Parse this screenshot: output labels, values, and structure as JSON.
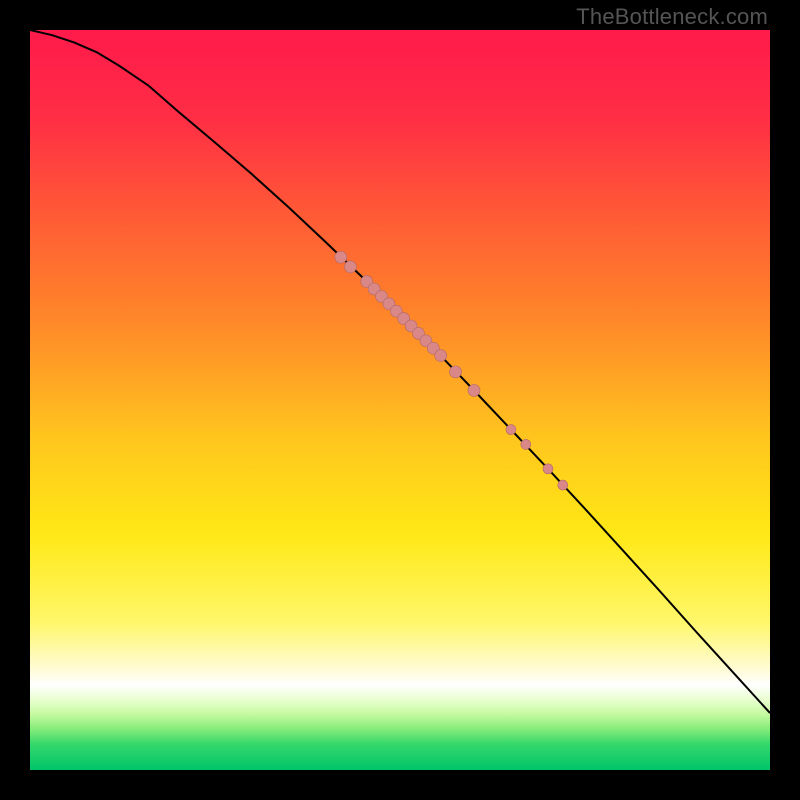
{
  "watermark": "TheBottleneck.com",
  "chart_data": {
    "type": "line",
    "title": "",
    "xlabel": "",
    "ylabel": "",
    "xlim": [
      0,
      100
    ],
    "ylim": [
      0,
      100
    ],
    "background_gradient_stops": [
      {
        "offset": 0.0,
        "color": "#ff1a4b"
      },
      {
        "offset": 0.12,
        "color": "#ff2e45"
      },
      {
        "offset": 0.25,
        "color": "#ff5a36"
      },
      {
        "offset": 0.4,
        "color": "#ff8a28"
      },
      {
        "offset": 0.55,
        "color": "#ffc51e"
      },
      {
        "offset": 0.68,
        "color": "#ffe815"
      },
      {
        "offset": 0.8,
        "color": "#fff76a"
      },
      {
        "offset": 0.86,
        "color": "#fffbcf"
      },
      {
        "offset": 0.885,
        "color": "#ffffff"
      },
      {
        "offset": 0.905,
        "color": "#e9ffd0"
      },
      {
        "offset": 0.925,
        "color": "#c5f9a0"
      },
      {
        "offset": 0.945,
        "color": "#84ec7a"
      },
      {
        "offset": 0.965,
        "color": "#35d86b"
      },
      {
        "offset": 1.0,
        "color": "#00c46a"
      }
    ],
    "series": [
      {
        "name": "curve",
        "stroke": "#000000",
        "x": [
          0,
          3,
          6,
          9,
          12,
          16,
          20,
          25,
          30,
          35,
          40,
          45,
          50,
          55,
          60,
          65,
          70,
          75,
          80,
          85,
          90,
          95,
          100
        ],
        "y": [
          100,
          99.3,
          98.3,
          97.0,
          95.2,
          92.5,
          89.0,
          84.8,
          80.5,
          76.0,
          71.3,
          66.5,
          61.5,
          56.5,
          51.3,
          46.0,
          40.7,
          35.3,
          29.8,
          24.3,
          18.7,
          13.2,
          7.7
        ]
      }
    ],
    "markers": {
      "color": "#d98787",
      "border": "#b06868",
      "radius_main": 6,
      "radius_small": 5,
      "points_main": [
        {
          "x": 42.0,
          "y": 69.3
        },
        {
          "x": 43.3,
          "y": 68.0
        },
        {
          "x": 45.5,
          "y": 66.0
        },
        {
          "x": 46.5,
          "y": 65.0
        },
        {
          "x": 47.5,
          "y": 64.0
        },
        {
          "x": 48.5,
          "y": 63.0
        },
        {
          "x": 49.5,
          "y": 62.0
        },
        {
          "x": 50.5,
          "y": 61.0
        },
        {
          "x": 51.5,
          "y": 60.0
        },
        {
          "x": 52.5,
          "y": 59.0
        },
        {
          "x": 53.5,
          "y": 58.0
        },
        {
          "x": 54.5,
          "y": 57.0
        },
        {
          "x": 55.5,
          "y": 56.0
        },
        {
          "x": 57.5,
          "y": 53.8
        },
        {
          "x": 60.0,
          "y": 51.3
        }
      ],
      "points_small": [
        {
          "x": 65.0,
          "y": 46.0
        },
        {
          "x": 67.0,
          "y": 44.0
        },
        {
          "x": 70.0,
          "y": 40.7
        },
        {
          "x": 72.0,
          "y": 38.5
        }
      ]
    }
  }
}
